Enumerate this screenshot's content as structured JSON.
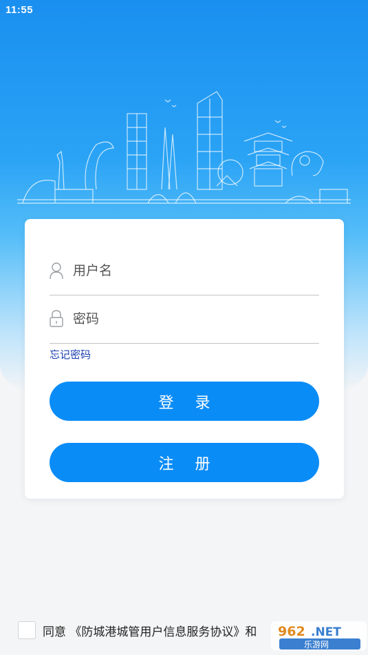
{
  "status_bar": {
    "time": "11:55"
  },
  "login": {
    "username_placeholder": "用户名",
    "password_placeholder": "密码",
    "forgot_password": "忘记密码",
    "login_button": "登 录",
    "register_button": "注 册"
  },
  "agreement": {
    "text": "同意 《防城港城管用户信息服务协议》和"
  },
  "watermark": {
    "text": "962.NET 乐游网"
  },
  "colors": {
    "accent": "#0a8cf7",
    "link": "#1a3fb0",
    "hero_top": "#1a8ff0"
  },
  "icons": {
    "username": "user-icon",
    "password": "lock-icon"
  }
}
